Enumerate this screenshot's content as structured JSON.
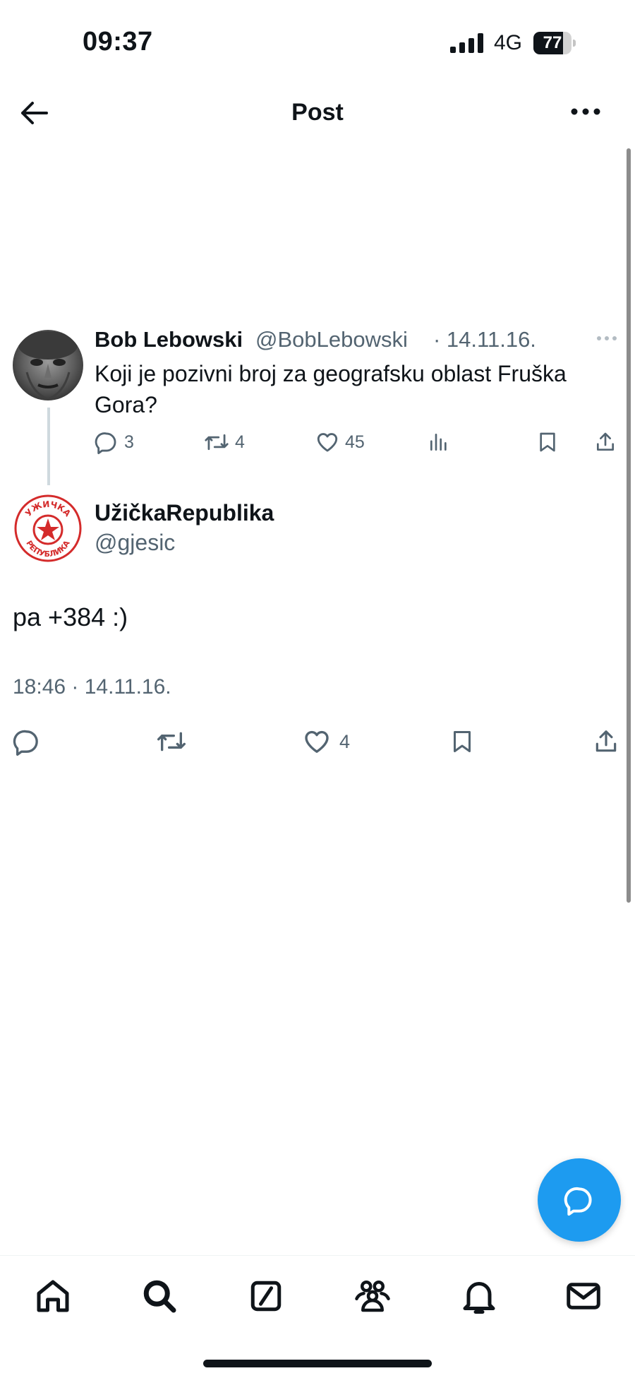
{
  "status_bar": {
    "time": "09:37",
    "network": "4G",
    "battery": "77",
    "battery_level": 0.77
  },
  "header": {
    "title": "Post"
  },
  "parent_post": {
    "author_name": "Bob Lebowski",
    "author_handle": "@BobLebowski",
    "date": "· 14.11.16.",
    "text": "Koji je pozivni broj za geografsku oblast Fruška Gora?",
    "replies": "3",
    "reposts": "4",
    "likes": "45"
  },
  "main_post": {
    "author_name": "UžičkaRepublika",
    "author_handle": "@gjesic",
    "text": "pa +384 :)",
    "timestamp": "18:46 · 14.11.16.",
    "likes": "4",
    "avatar_text": "УЖИЧКА РЕПУБЛИКА"
  },
  "colors": {
    "accent": "#1d9bf0",
    "text_primary": "#0f1419",
    "text_secondary": "#536471",
    "avatar_red": "#d42b2b"
  },
  "icons": {
    "back": "arrow-left-icon",
    "more": "more-horizontal-icon",
    "reply": "reply-icon",
    "repost": "repost-icon",
    "like": "heart-icon",
    "views": "views-icon",
    "bookmark": "bookmark-icon",
    "share": "share-icon",
    "fab": "compose-reply-icon",
    "nav": [
      "home-icon",
      "search-icon",
      "grok-icon",
      "communities-icon",
      "notifications-icon",
      "messages-icon"
    ]
  }
}
